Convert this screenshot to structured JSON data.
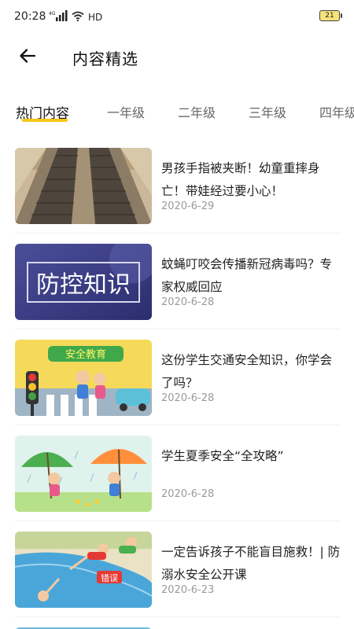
{
  "status_bar": {
    "time": "20:28",
    "network": "4G",
    "hd": "HD",
    "battery": "21"
  },
  "header": {
    "title": "内容精选",
    "back_icon": "arrow-left-icon"
  },
  "tabs": [
    {
      "label": "热门内容",
      "active": true
    },
    {
      "label": "一年级",
      "active": false
    },
    {
      "label": "二年级",
      "active": false
    },
    {
      "label": "三年级",
      "active": false
    },
    {
      "label": "四年级",
      "active": false
    }
  ],
  "accent_color": "#f5c518",
  "articles": [
    {
      "title": "男孩手指被夹断！幼童重摔身亡！带娃经过要小心！",
      "date": "2020-6-29"
    },
    {
      "title": "蚊蝇叮咬会传播新冠病毒吗？专家权威回应",
      "date": "2020-6-28",
      "thumb_text": "防控知识"
    },
    {
      "title": "这份学生交通安全知识，你学会了吗？",
      "date": "2020-6-28",
      "thumb_text": "安全教育"
    },
    {
      "title": "学生夏季安全“全攻略”",
      "date": "2020-6-28"
    },
    {
      "title": "一定告诉孩子不能盲目施救！| 防溺水安全公开课",
      "date": "2020-6-23",
      "thumb_text": "错误"
    }
  ]
}
